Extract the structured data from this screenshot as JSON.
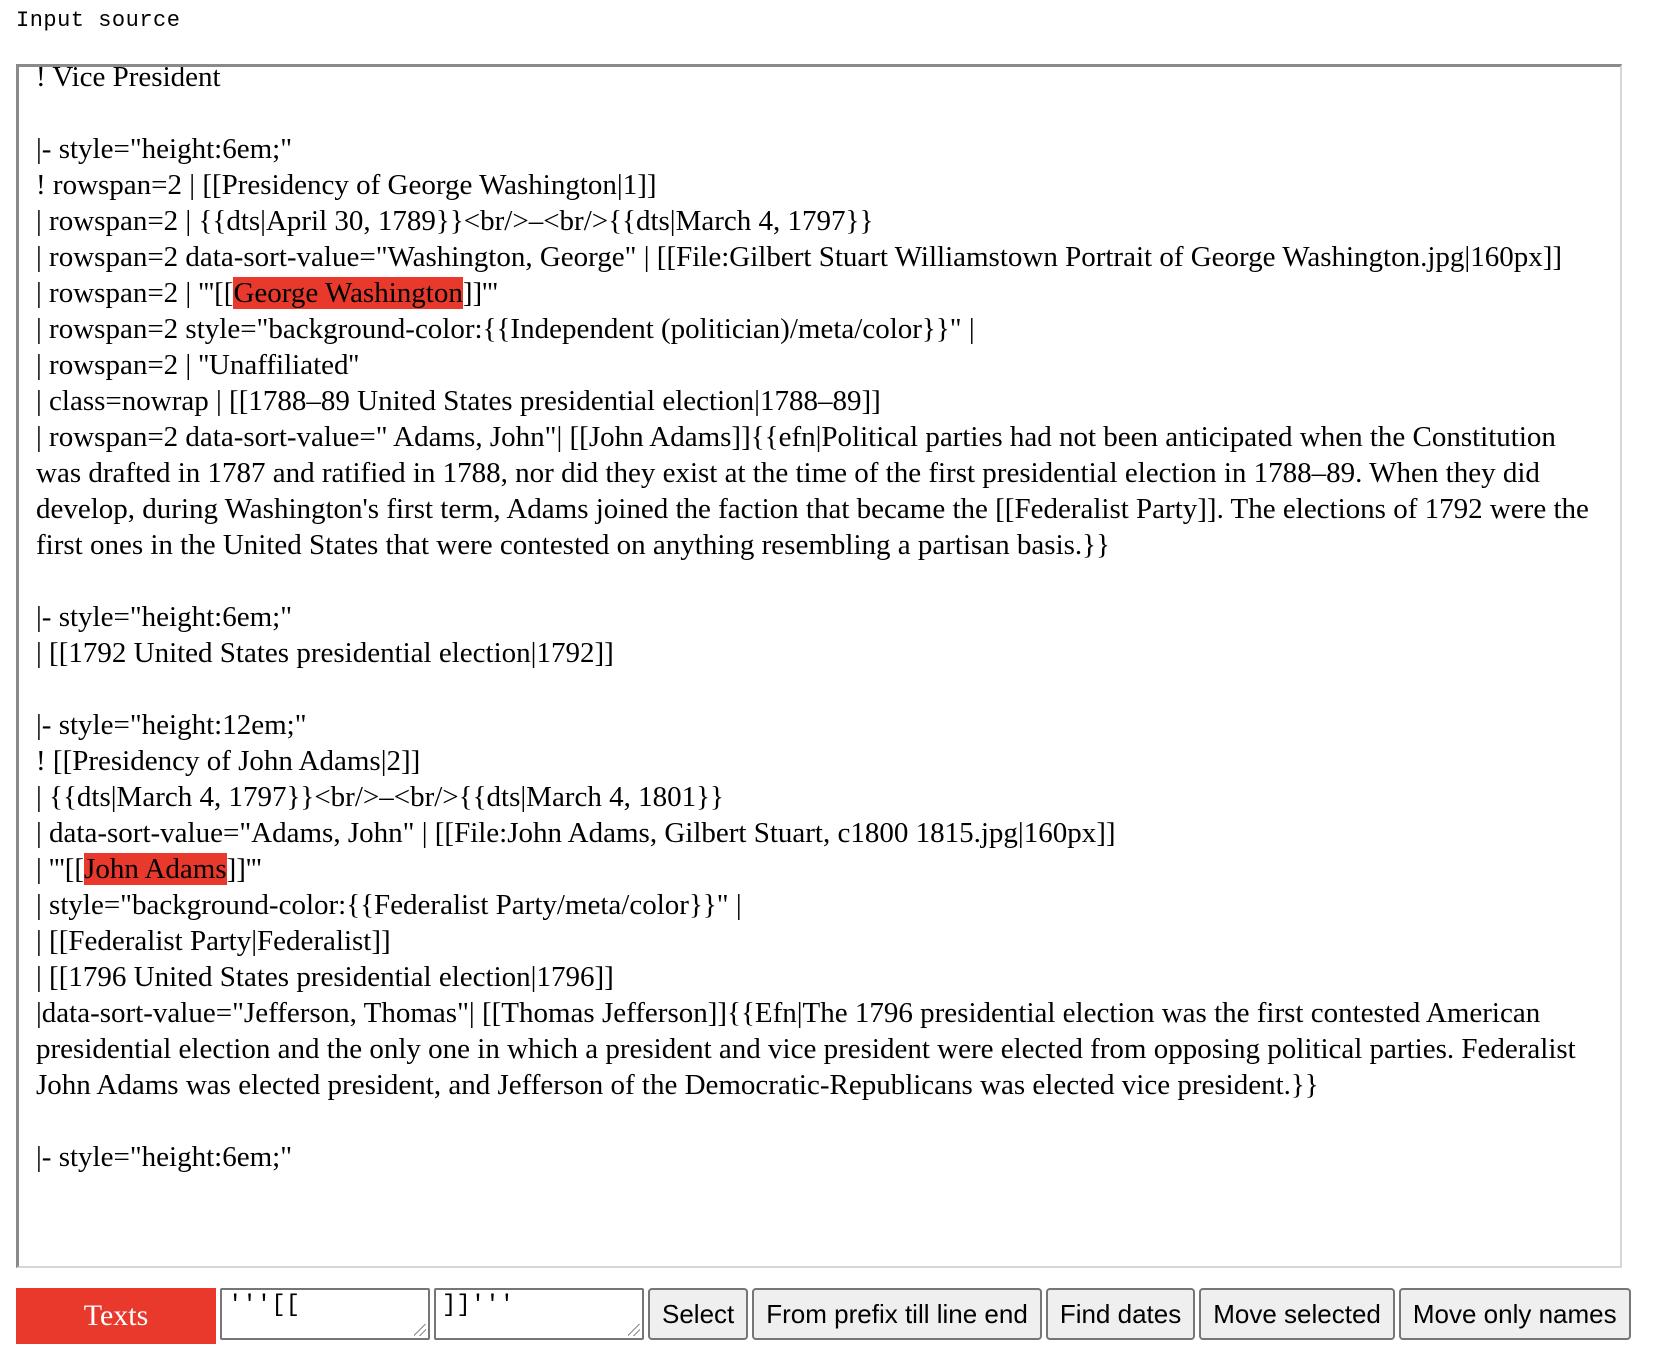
{
  "source_label": "Input source",
  "editor": {
    "lines": [
      {
        "text": "! Vice President"
      },
      {
        "text": ""
      },
      {
        "text": "|- style=\"height:6em;\""
      },
      {
        "text": "! rowspan=2 | [[Presidency of George Washington|1]]"
      },
      {
        "text": "| rowspan=2 | {{dts|April 30, 1789}}<br/>–<br/>{{dts|March 4, 1797}}"
      },
      {
        "text": "| rowspan=2 data-sort-value=\"Washington, George\" | [[File:Gilbert Stuart Williamstown Portrait of George Washington.jpg|160px]]"
      },
      {
        "before": "| rowspan=2 | '''[[",
        "highlight": "George Washington",
        "after": "]]'''"
      },
      {
        "text": "| rowspan=2 style=\"background-color:{{Independent (politician)/meta/color}}\" |"
      },
      {
        "text": "| rowspan=2 | ''Unaffiliated''"
      },
      {
        "text": "| class=nowrap | [[1788–89 United States presidential election|1788–89]]"
      },
      {
        "text": "| rowspan=2 data-sort-value=\" Adams, John\"| [[John Adams]]{{efn|Political parties had not been anticipated when the Constitution was drafted in 1787 and ratified in 1788, nor did they exist at the time of the first presidential election in 1788–89. When they did develop, during Washington's first term, Adams joined the faction that became the [[Federalist Party]]. The elections of 1792 were the first ones in the United States that were contested on anything resembling a partisan basis.}}"
      },
      {
        "text": ""
      },
      {
        "text": "|- style=\"height:6em;\""
      },
      {
        "text": "| [[1792 United States presidential election|1792]]"
      },
      {
        "text": ""
      },
      {
        "text": "|- style=\"height:12em;\""
      },
      {
        "text": "! [[Presidency of John Adams|2]]"
      },
      {
        "text": "| {{dts|March 4, 1797}}<br/>–<br/>{{dts|March 4, 1801}}"
      },
      {
        "text": "| data-sort-value=\"Adams, John\" | [[File:John Adams, Gilbert Stuart, c1800 1815.jpg|160px]]"
      },
      {
        "before": "| '''[[",
        "highlight": "John Adams",
        "after": "]]'''"
      },
      {
        "text": "| style=\"background-color:{{Federalist Party/meta/color}}\" |"
      },
      {
        "text": "| [[Federalist Party|Federalist]]"
      },
      {
        "text": "| [[1796 United States presidential election|1796]]"
      },
      {
        "text": "|data-sort-value=\"Jefferson, Thomas\"| [[Thomas Jefferson]]{{Efn|The 1796 presidential election was the first contested American presidential election and the only one in which a president and vice president were elected from opposing political parties. Federalist John Adams was elected president, and Jefferson of the Democratic-Republicans was elected vice president.}}"
      },
      {
        "text": ""
      },
      {
        "text": "|- style=\"height:6em;\""
      }
    ]
  },
  "toolbar": {
    "texts_label": "Texts",
    "prefix_value": "'''[[",
    "suffix_value": "]]'''",
    "select_label": "Select",
    "prefix_line_end_label": "From prefix till line end",
    "find_dates_label": "Find dates",
    "move_selected_label": "Move selected",
    "move_names_label": "Move only names"
  },
  "colors": {
    "highlight": "#e8392c",
    "texts_button": "#e8392c"
  }
}
